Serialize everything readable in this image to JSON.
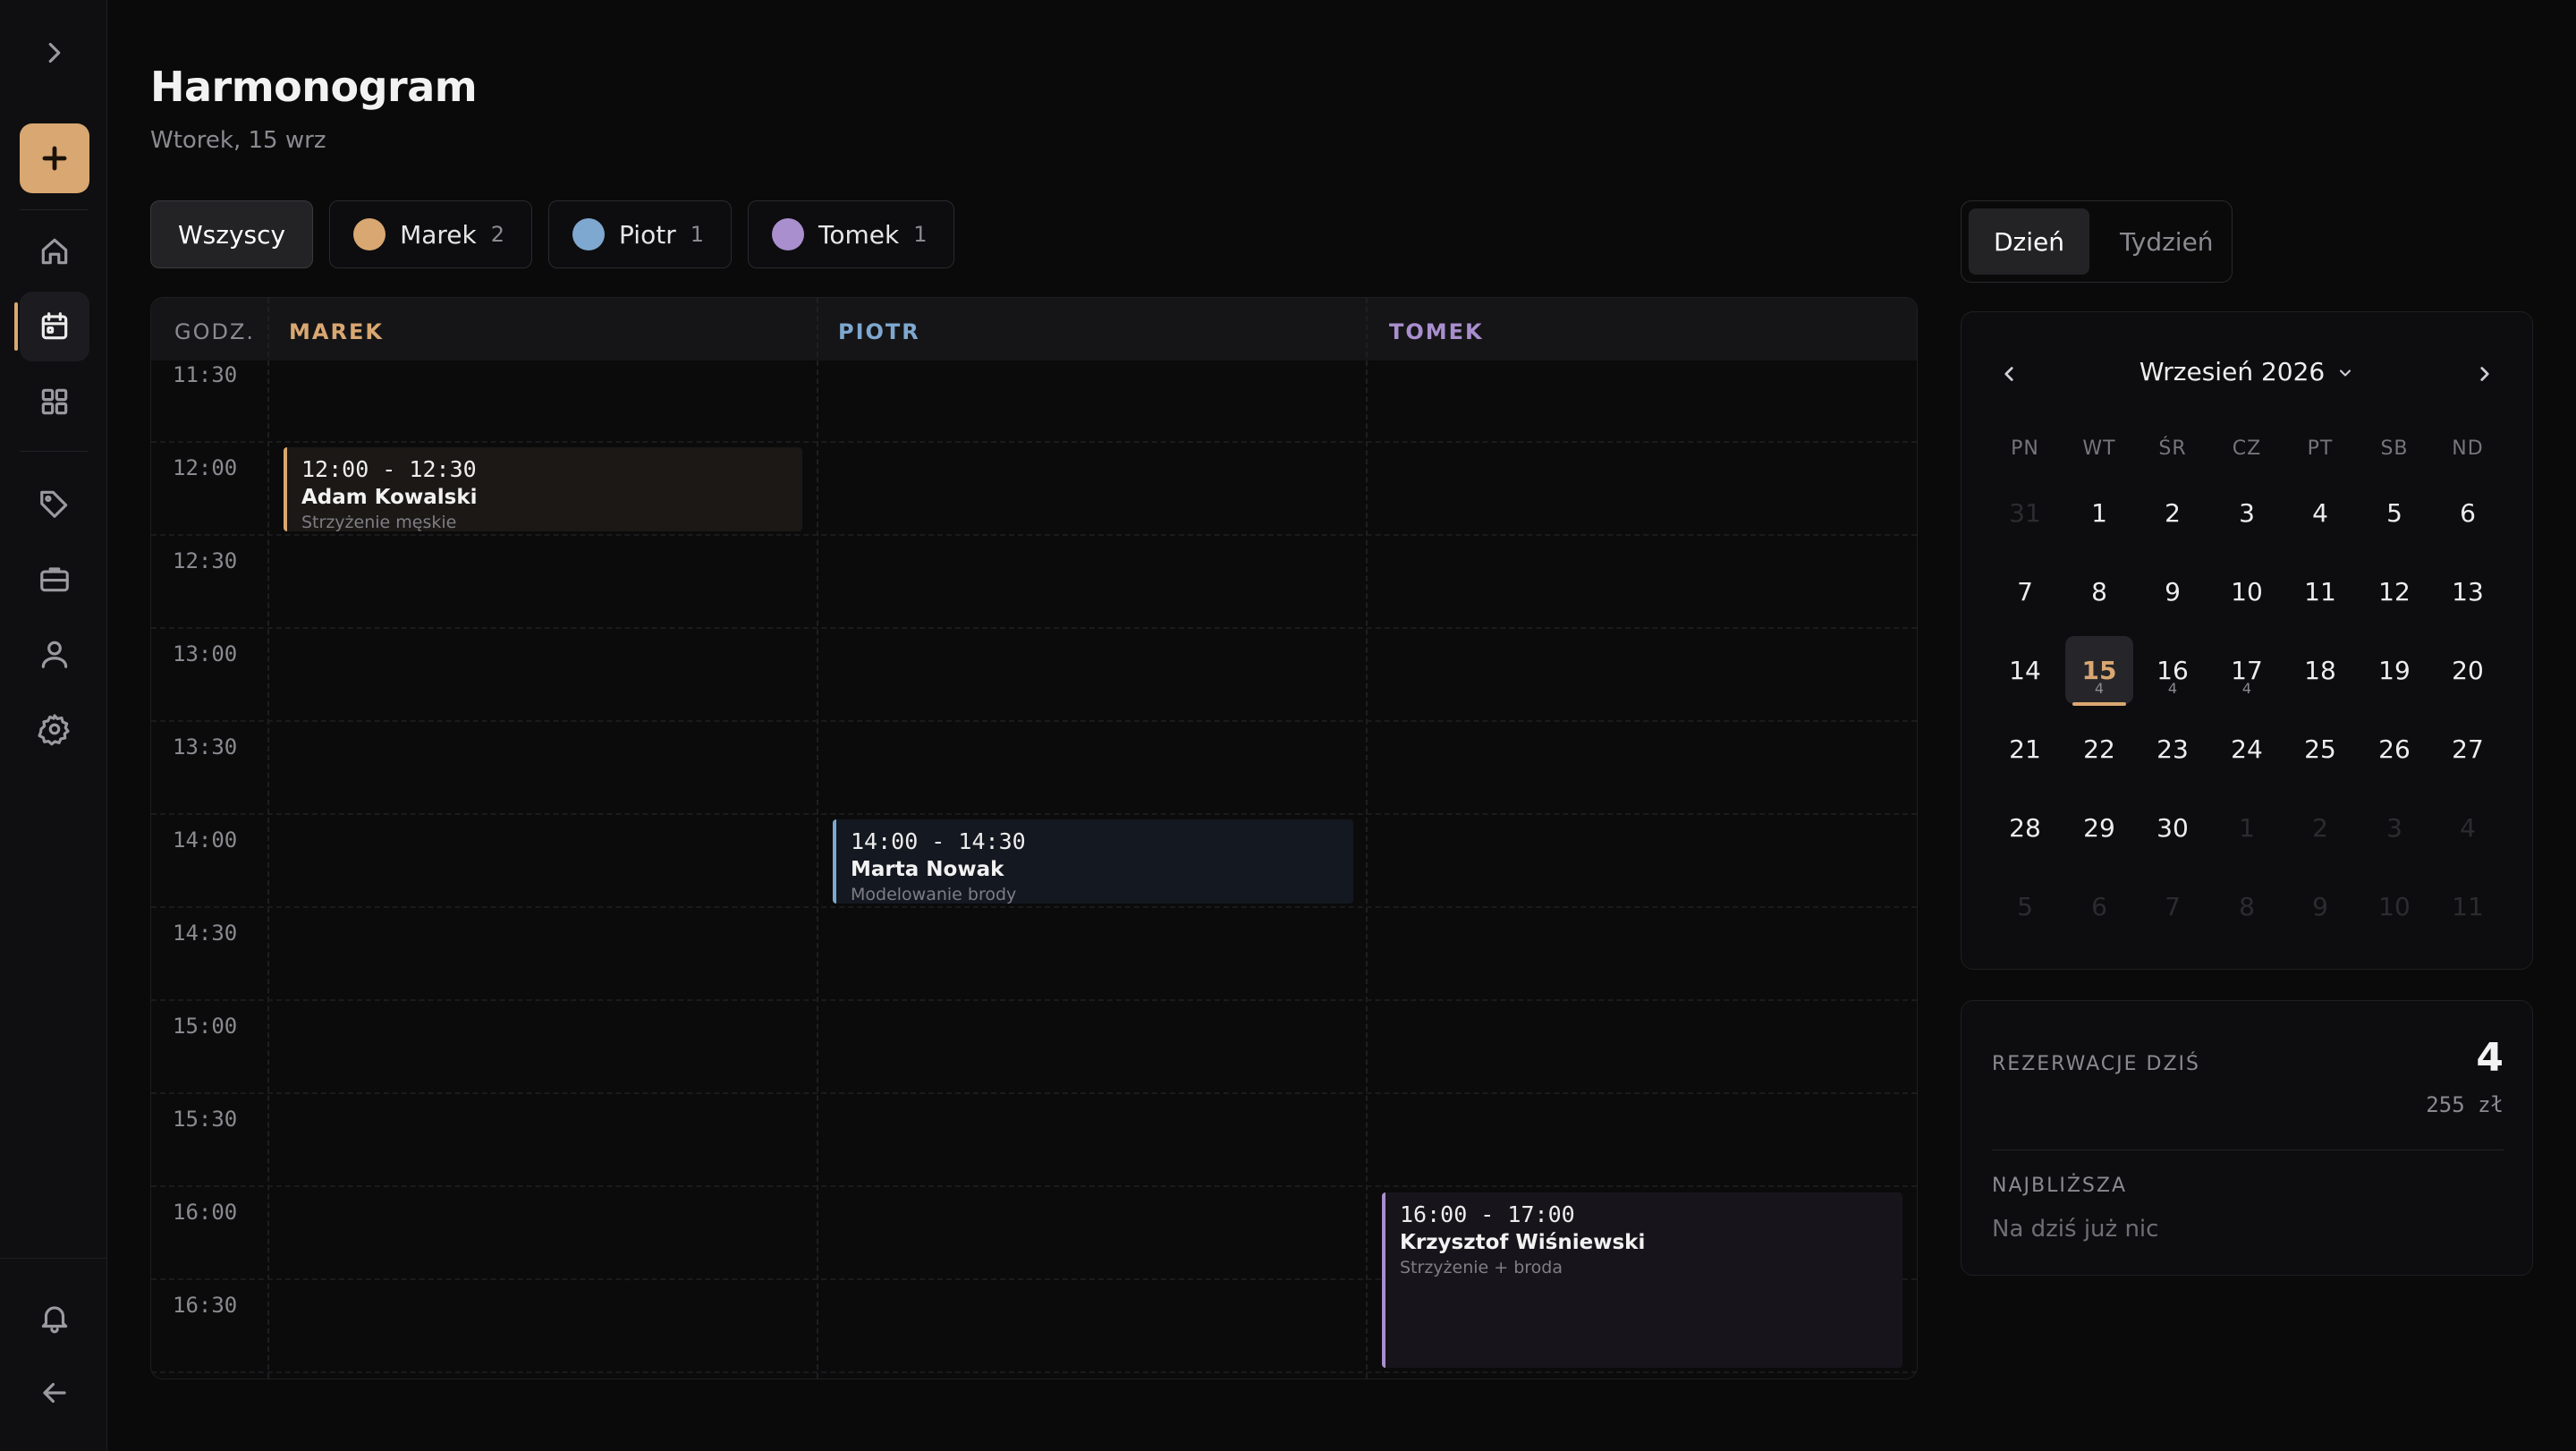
{
  "header": {
    "title": "Harmonogram",
    "subtitle": "Wtorek, 15 wrz"
  },
  "filters": [
    {
      "label": "Wszyscy",
      "count": "",
      "color": ""
    },
    {
      "label": "Marek",
      "count": "2",
      "color": "#d9a771"
    },
    {
      "label": "Piotr",
      "count": "1",
      "color": "#7ea8cf"
    },
    {
      "label": "Tomek",
      "count": "1",
      "color": "#a98fce"
    }
  ],
  "schedule": {
    "time_header": "GODZ.",
    "columns": [
      "MAREK",
      "PIOTR",
      "TOMEK"
    ],
    "times": [
      "11:30",
      "12:00",
      "12:30",
      "13:00",
      "13:30",
      "14:00",
      "14:30",
      "15:00",
      "15:30",
      "16:00",
      "16:30"
    ],
    "events": {
      "marek": {
        "time": "12:00 - 12:30",
        "client": "Adam Kowalski",
        "service": "Strzyżenie męskie"
      },
      "piotr": {
        "time": "14:00 - 14:30",
        "client": "Marta Nowak",
        "service": "Modelowanie brody"
      },
      "tomek": {
        "time": "16:00 - 17:00",
        "client": "Krzysztof Wiśniewski",
        "service": "Strzyżenie + broda"
      }
    }
  },
  "view_toggle": {
    "day": "Dzień",
    "week": "Tydzień"
  },
  "calendar": {
    "month": "Wrzesień 2026",
    "weekdays": [
      "PN",
      "WT",
      "ŚR",
      "CZ",
      "PT",
      "SB",
      "ND"
    ],
    "days": [
      {
        "d": "31",
        "dim": true
      },
      {
        "d": "1"
      },
      {
        "d": "2"
      },
      {
        "d": "3"
      },
      {
        "d": "4"
      },
      {
        "d": "5"
      },
      {
        "d": "6"
      },
      {
        "d": "7"
      },
      {
        "d": "8"
      },
      {
        "d": "9"
      },
      {
        "d": "10"
      },
      {
        "d": "11"
      },
      {
        "d": "12"
      },
      {
        "d": "13"
      },
      {
        "d": "14"
      },
      {
        "d": "15",
        "today": true,
        "count": "4"
      },
      {
        "d": "16",
        "count": "4"
      },
      {
        "d": "17",
        "count": "4"
      },
      {
        "d": "18"
      },
      {
        "d": "19"
      },
      {
        "d": "20"
      },
      {
        "d": "21"
      },
      {
        "d": "22"
      },
      {
        "d": "23"
      },
      {
        "d": "24"
      },
      {
        "d": "25"
      },
      {
        "d": "26"
      },
      {
        "d": "27"
      },
      {
        "d": "28"
      },
      {
        "d": "29"
      },
      {
        "d": "30"
      },
      {
        "d": "1",
        "dim": true
      },
      {
        "d": "2",
        "dim": true
      },
      {
        "d": "3",
        "dim": true
      },
      {
        "d": "4",
        "dim": true
      },
      {
        "d": "5",
        "dim": true
      },
      {
        "d": "6",
        "dim": true
      },
      {
        "d": "7",
        "dim": true
      },
      {
        "d": "8",
        "dim": true
      },
      {
        "d": "9",
        "dim": true
      },
      {
        "d": "10",
        "dim": true
      },
      {
        "d": "11",
        "dim": true
      }
    ]
  },
  "summary": {
    "label": "REZERWACJE DZIŚ",
    "count": "4",
    "amount": "255 zł",
    "next_label": "NAJBLIŻSZA",
    "next_value": "Na dziś już nic"
  },
  "icons": {
    "expand": "chevron-right-icon",
    "add": "plus-icon",
    "home": "home-icon",
    "calendar": "calendar-icon",
    "grid": "grid-icon",
    "tag": "tag-icon",
    "briefcase": "briefcase-icon",
    "user": "user-icon",
    "settings": "gear-icon",
    "notifications": "bell-icon",
    "back": "arrow-left-icon"
  },
  "colors": {
    "accent": "#d9a771",
    "marek": "#d9a771",
    "piotr": "#7ea8cf",
    "tomek": "#a98fce"
  }
}
